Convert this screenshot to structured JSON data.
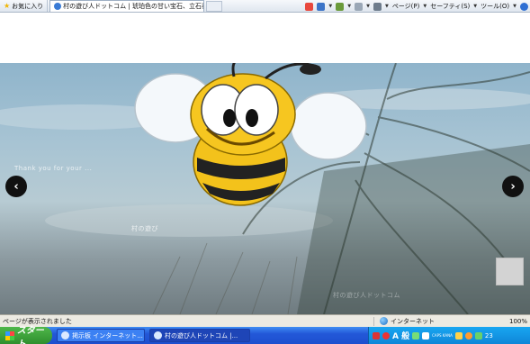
{
  "browser": {
    "favorites_label": "お気に入り",
    "tab_title": "村の遊び人ドットコム | 琥珀色の甘い宝石、立石養蜂...",
    "menu": [
      "ページ(P)",
      "セーフティ(S)",
      "ツール(O)"
    ]
  },
  "hero": {
    "caption_left": "Thank you for your ...",
    "caption_center": "村の遊び",
    "caption_bottom": "村の遊び人ドットコム",
    "prev_symbol": "‹",
    "next_symbol": "›"
  },
  "status": {
    "message": "ページが表示されました",
    "zone": "インターネット",
    "zoom": "100%"
  },
  "taskbar": {
    "start_label": "スタート",
    "tasks": [
      "掲示板 インターネット...",
      "村の遊び人ドットコム |..."
    ],
    "ime_label": "A 般",
    "caps_label": "CAPS KANA",
    "clock": "23"
  },
  "colors": {
    "taskbar_blue": "#2358d8",
    "start_green": "#3a9e36",
    "tray_blue": "#0f86d8",
    "bee_yellow": "#f3c21b"
  }
}
